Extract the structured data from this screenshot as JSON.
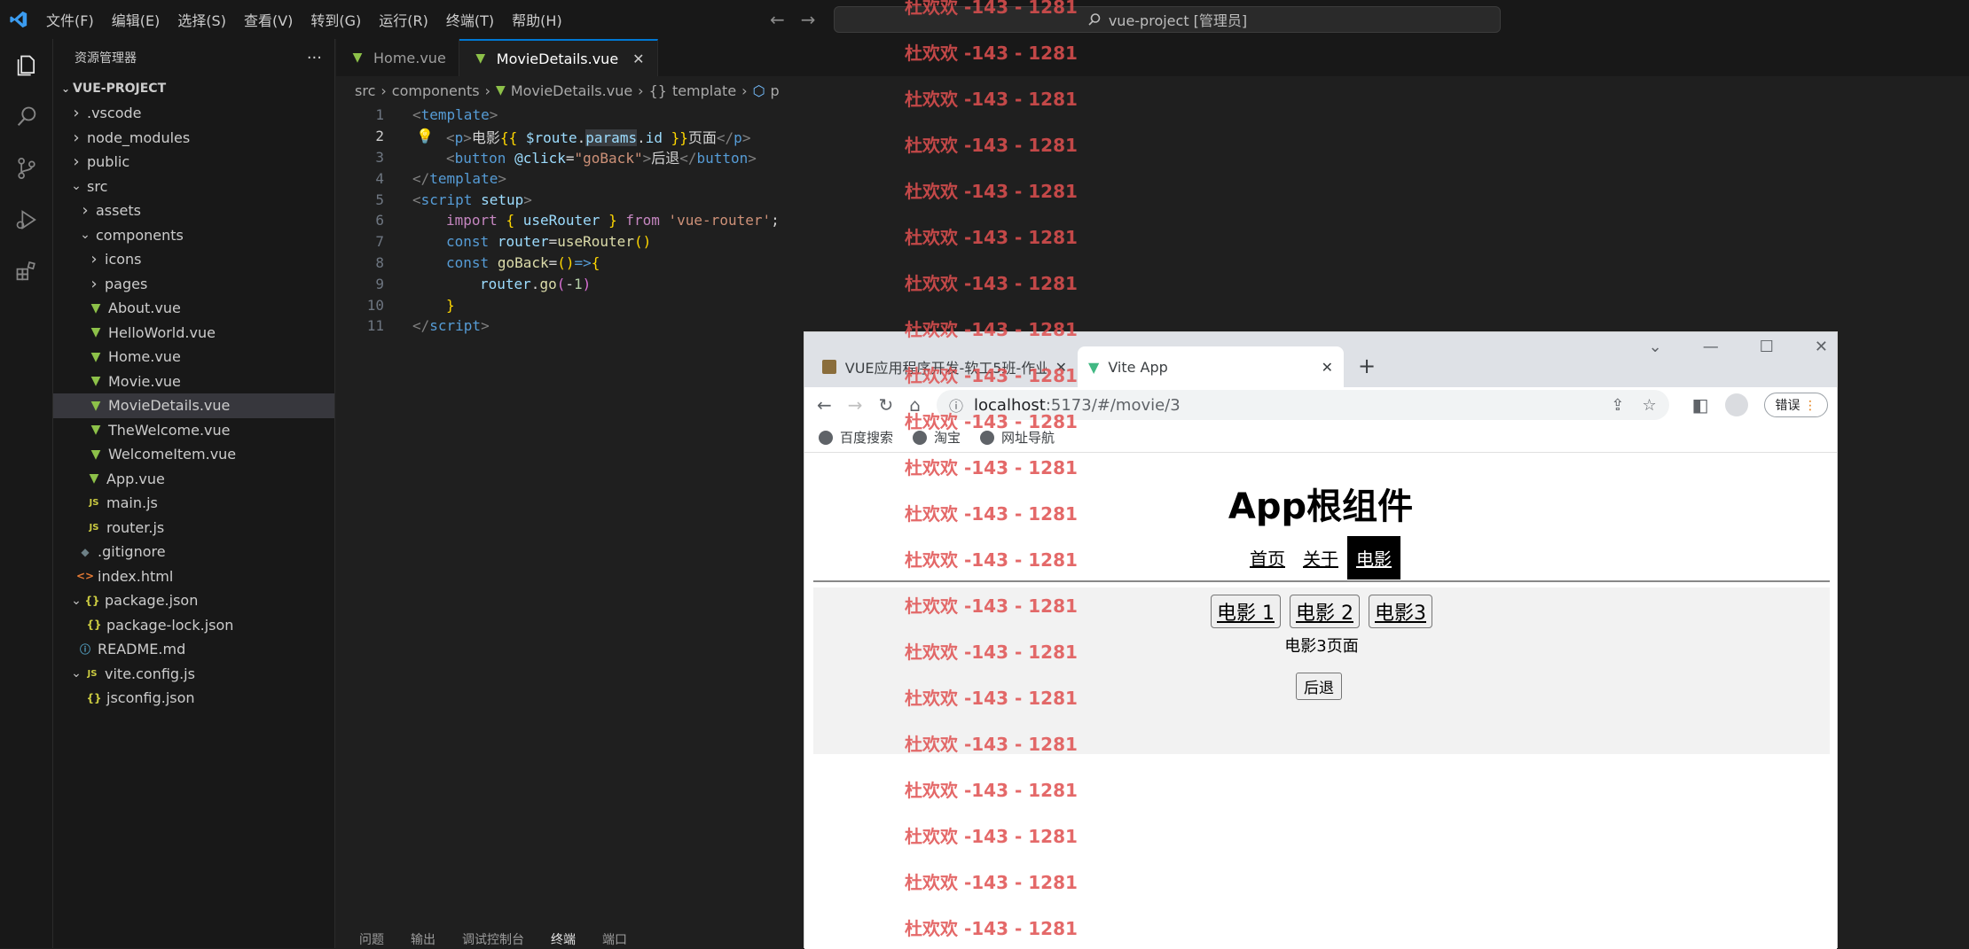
{
  "titlebar": {
    "menus": [
      "文件(F)",
      "编辑(E)",
      "选择(S)",
      "查看(V)",
      "转到(G)",
      "运行(R)",
      "终端(T)",
      "帮助(H)"
    ],
    "search_text": "vue-project [管理员]"
  },
  "sidebar": {
    "header": "资源管理器",
    "more": "···",
    "root": "VUE-PROJECT",
    "items": [
      {
        "label": ".vscode",
        "indent": 1,
        "type": "folder",
        "open": false
      },
      {
        "label": "node_modules",
        "indent": 1,
        "type": "folder",
        "open": false
      },
      {
        "label": "public",
        "indent": 1,
        "type": "folder",
        "open": false
      },
      {
        "label": "src",
        "indent": 1,
        "type": "folder",
        "open": true
      },
      {
        "label": "assets",
        "indent": 2,
        "type": "folder",
        "open": false
      },
      {
        "label": "components",
        "indent": 2,
        "type": "folder",
        "open": true
      },
      {
        "label": "icons",
        "indent": 3,
        "type": "folder",
        "open": false
      },
      {
        "label": "pages",
        "indent": 3,
        "type": "folder",
        "open": false
      },
      {
        "label": "About.vue",
        "indent": 3,
        "type": "vue"
      },
      {
        "label": "HelloWorld.vue",
        "indent": 3,
        "type": "vue"
      },
      {
        "label": "Home.vue",
        "indent": 3,
        "type": "vue"
      },
      {
        "label": "Movie.vue",
        "indent": 3,
        "type": "vue"
      },
      {
        "label": "MovieDetails.vue",
        "indent": 3,
        "type": "vue",
        "selected": true
      },
      {
        "label": "TheWelcome.vue",
        "indent": 3,
        "type": "vue"
      },
      {
        "label": "WelcomeItem.vue",
        "indent": 3,
        "type": "vue"
      },
      {
        "label": "App.vue",
        "indent": 2,
        "type": "vue"
      },
      {
        "label": "main.js",
        "indent": 2,
        "type": "js"
      },
      {
        "label": "router.js",
        "indent": 2,
        "type": "js"
      },
      {
        "label": ".gitignore",
        "indent": 1,
        "type": "git"
      },
      {
        "label": "index.html",
        "indent": 1,
        "type": "html"
      },
      {
        "label": "package.json",
        "indent": 1,
        "type": "jsonfolder",
        "open": true
      },
      {
        "label": "package-lock.json",
        "indent": 2,
        "type": "json"
      },
      {
        "label": "README.md",
        "indent": 1,
        "type": "md"
      },
      {
        "label": "vite.config.js",
        "indent": 1,
        "type": "jsfolder",
        "open": true
      },
      {
        "label": "jsconfig.json",
        "indent": 2,
        "type": "json"
      }
    ]
  },
  "tabs": [
    {
      "label": "Home.vue",
      "active": false
    },
    {
      "label": "MovieDetails.vue",
      "active": true,
      "close": "✕"
    }
  ],
  "breadcrumb": [
    "src",
    "components",
    "MovieDetails.vue",
    "template",
    "p"
  ],
  "editor": {
    "line_numbers": [
      "1",
      "2",
      "3",
      "4",
      "5",
      "6",
      "7",
      "8",
      "9",
      "10",
      "11"
    ],
    "current_line": "2"
  },
  "panel_tabs": [
    "问题",
    "输出",
    "调试控制台",
    "终端",
    "端口"
  ],
  "watermark": "杜欢欢 -143 - 1281",
  "browser": {
    "tab1": "VUE应用程序开发-软工5班-作业",
    "tab2": "Vite App",
    "tab_close": "✕",
    "new_tab": "+",
    "url_host": "localhost",
    "url_rest": ":5173/#/movie/3",
    "error_button": "错误",
    "bookmarks": [
      "百度搜索",
      "淘宝",
      "网址导航"
    ],
    "page": {
      "heading": "App根组件",
      "nav": [
        "首页",
        "关于",
        "电影"
      ],
      "active_nav": "电影",
      "movie_links": [
        "电影 1",
        "电影 2",
        "电影3"
      ],
      "movie_text": "电影3页面",
      "back_button": "后退"
    }
  },
  "colors": {
    "accent": "#0078d4",
    "vue_green": "#8dc149",
    "watermark_red": "#e05050"
  }
}
